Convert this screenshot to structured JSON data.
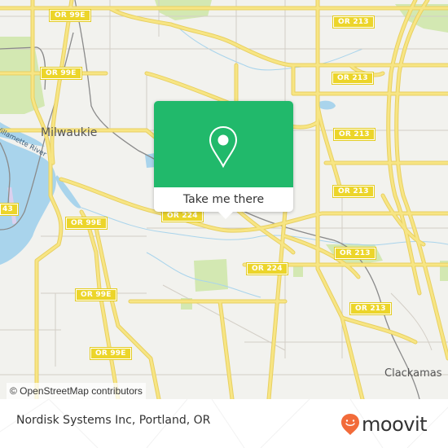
{
  "map": {
    "attribution": "© OpenStreetMap contributors",
    "place_labels": [
      {
        "id": "milwaukie",
        "text": "Milwaukie"
      },
      {
        "id": "clackamas",
        "text": "Clackamas"
      }
    ],
    "water_labels": [
      {
        "id": "willamette-river",
        "text": "Willamette River"
      }
    ],
    "road_shields": [
      {
        "id": "or99e-1",
        "text": "OR 99E"
      },
      {
        "id": "or99e-2",
        "text": "OR 99E"
      },
      {
        "id": "or99e-3",
        "text": "OR 99E"
      },
      {
        "id": "or99e-4",
        "text": "OR 99E"
      },
      {
        "id": "or99e-5",
        "text": "OR 99E"
      },
      {
        "id": "or43",
        "text": "43"
      },
      {
        "id": "or224-1",
        "text": "OR 224"
      },
      {
        "id": "or224-2",
        "text": "OR 224"
      },
      {
        "id": "or213-1",
        "text": "OR 213"
      },
      {
        "id": "or213-2",
        "text": "OR 213"
      },
      {
        "id": "or213-3",
        "text": "OR 213"
      },
      {
        "id": "or213-4",
        "text": "OR 213"
      },
      {
        "id": "or213-5",
        "text": "OR 213"
      },
      {
        "id": "or213-6",
        "text": "OR 213"
      },
      {
        "id": "or213-7",
        "text": "OR 213"
      }
    ],
    "colors": {
      "land": "#f2f2ee",
      "water": "#a9d4ec",
      "park": "#cfe6ad",
      "road_major": "#f4de6a",
      "road_minor": "#cfcac2",
      "rail": "#888888"
    }
  },
  "popup": {
    "icon": "location-pin-icon",
    "cta_label": "Take me there",
    "accent_color": "#21b96b"
  },
  "footer": {
    "location_name": "Nordisk Systems Inc, Portland, OR",
    "brand": "moovit",
    "brand_color": "#f26b3a"
  }
}
